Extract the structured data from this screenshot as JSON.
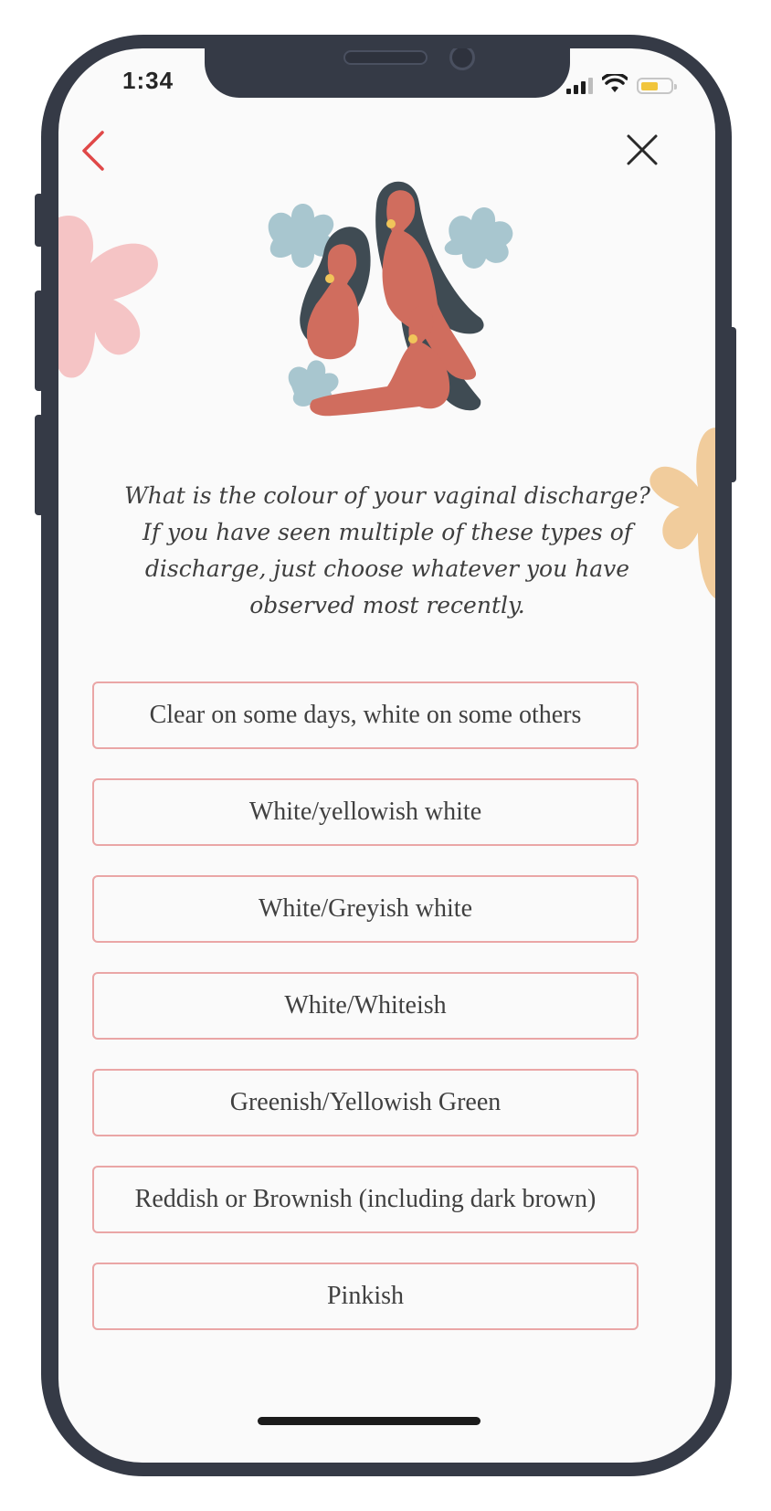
{
  "status_bar": {
    "time": "1:34",
    "battery_color": "#f1c53c"
  },
  "nav": {
    "back_icon": "chevron-left-icon",
    "close_icon": "close-icon",
    "accent": "#e04848"
  },
  "question": "What is the colour of your vaginal discharge?\nIf you have seen multiple of these types of\ndischarge, just choose whatever you have\nobserved most recently.",
  "options": [
    {
      "label": "Clear on some days, white on some others"
    },
    {
      "label": "White/yellowish white"
    },
    {
      "label": "White/Greyish white"
    },
    {
      "label": "White/Whiteish"
    },
    {
      "label": "Greenish/Yellowish Green"
    },
    {
      "label": "Reddish or Brownish (including dark brown)"
    },
    {
      "label": "Pinkish"
    }
  ],
  "colors": {
    "option_border": "#eaa6a6",
    "background": "#fafafa",
    "text": "#404040"
  }
}
